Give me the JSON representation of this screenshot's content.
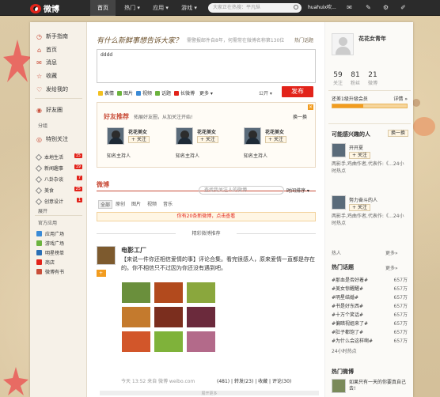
{
  "topbar": {
    "logo": "微博",
    "nav": [
      "首页",
      "热门 ▾",
      "应用 ▾",
      "游戏 ▾"
    ],
    "search_placeholder": "大家正在热搜：平凡纵",
    "user": "huahuix吹..."
  },
  "left_nav": {
    "items": [
      "新手指南",
      "首页",
      "消息",
      "收藏",
      "发给我的",
      "好友圈"
    ],
    "group_label": "分组",
    "special": "特别关注",
    "tags": [
      {
        "label": "本地生活",
        "count": "15"
      },
      {
        "label": "新闻趣事",
        "count": "19"
      },
      {
        "label": "八卦杂谈",
        "count": "7"
      },
      {
        "label": "美食",
        "count": "25"
      },
      {
        "label": "创意设计",
        "count": "1"
      }
    ],
    "expand": "展开",
    "apps_label": "官方应用",
    "apps": [
      "应用广场",
      "游戏广场",
      "明星榜单",
      "商店",
      "微博有书"
    ]
  },
  "publisher": {
    "prompt": "有什么新鲜事想告诉大家？",
    "hint": "需警报邮件自8年，何需常在微博名称第130位",
    "hot_topic": "热门话题",
    "text": "dddd",
    "tools": [
      "表情",
      "图片",
      "视频",
      "话题",
      "长微博",
      "更多 ▾"
    ],
    "visibility": "公开 ▾",
    "submit": "发布"
  },
  "friends": {
    "title": "好友推荐",
    "subtitle": "拓展好友圈，从加关注开始!",
    "swap": "换一换",
    "cards": [
      {
        "name": "花花美女",
        "follow": "+ 关注",
        "desc": "知名主持人"
      },
      {
        "name": "花花美女",
        "follow": "+ 关注",
        "desc": "知名主持人"
      },
      {
        "name": "花花美女",
        "follow": "+ 关注",
        "desc": "知名主持人"
      }
    ]
  },
  "feed": {
    "title": "微博",
    "search_placeholder": "查找我关注人的微博",
    "sort": "时间排序 ▾",
    "tabs": [
      "全部",
      "原创",
      "图片",
      "视频",
      "音乐"
    ],
    "new_notice": "你有20条新微博，点击查看",
    "recommend": "精彩微博推荐"
  },
  "post": {
    "author": "电影工厂",
    "follow": "+ 关注",
    "text": "【来说一件你还相信爱情的事】评论合集。看完很感人，原来爱情一直都是存在的。你不相信只不过因为你还没有遇到吧。",
    "meta": "今天 13:52 来自 微博 weibo.com",
    "actions": "(481) | 转发(23) | 收藏 | 评论(30)",
    "collapse": "展开更多"
  },
  "photos": [
    {
      "color": "#6a8f3c"
    },
    {
      "color": "#b24a1d"
    },
    {
      "color": "#8aa73d"
    },
    {
      "color": "#c47a2d"
    },
    {
      "color": "#7b2e1e"
    },
    {
      "color": "#6b2a3c"
    },
    {
      "color": "#d2562a"
    },
    {
      "color": "#7fb23a"
    },
    {
      "color": "#b36a8a"
    }
  ],
  "profile": {
    "name": "花花女青年",
    "stats": [
      {
        "n": "59",
        "l": "关注"
      },
      {
        "n": "81",
        "l": "粉丝"
      },
      {
        "n": "21",
        "l": "微博"
      }
    ],
    "level_text": "还差1级升级会员",
    "level_more": "详情 »",
    "level_progress": 0.42
  },
  "people": {
    "title": "可能感兴趣的人",
    "swap": "换一换",
    "items": [
      {
        "name": "开开夏",
        "follow": "+ 关注",
        "desc": "两影手,鸡曲作者,代表作:《…24小时热点"
      },
      {
        "name": "努力奋斗的人",
        "follow": "+ 关注",
        "desc": "两影手,鸡曲作者,代表作:《…24小时热点"
      }
    ],
    "more": "更多»"
  },
  "hot_topics": {
    "title": "热门话题",
    "more": "更多»",
    "items": [
      {
        "t": "#那血是否好着#",
        "v": "657万"
      },
      {
        "t": "#美女惊醒醒#",
        "v": "657万"
      },
      {
        "t": "#明星结婚#",
        "v": "657万"
      },
      {
        "t": "#书是好东西#",
        "v": "657万"
      },
      {
        "t": "#十万个笑话#",
        "v": "657万"
      },
      {
        "t": "#偏暗视姐来了#",
        "v": "657万"
      },
      {
        "t": "#肚子都饱了#",
        "v": "657万"
      },
      {
        "t": "#为什么会这样啊#",
        "v": "657万"
      }
    ],
    "footer": "24小时热点"
  },
  "hot_weibo": {
    "title": "热门微博",
    "text": "如果只有一天的你要真自己去!"
  },
  "accent": "#e2231a"
}
